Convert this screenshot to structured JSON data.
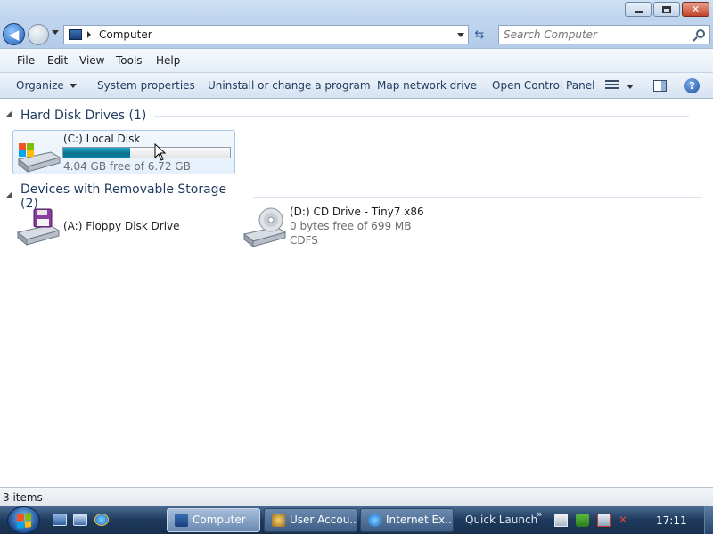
{
  "window": {
    "caption_buttons": {
      "minimize": "minimize",
      "maximize": "maximize",
      "close": "✕"
    }
  },
  "address": {
    "path": "Computer",
    "search_placeholder": "Search Computer"
  },
  "menu": {
    "items": [
      "File",
      "Edit",
      "View",
      "Tools",
      "Help"
    ]
  },
  "commands": {
    "items": [
      "Organize",
      "System properties",
      "Uninstall or change a program",
      "Map network drive",
      "Open Control Panel"
    ]
  },
  "groups": [
    {
      "header": "Hard Disk Drives (1)",
      "tiles": [
        {
          "name": "(C:) Local Disk",
          "detail": "4.04 GB free of 6.72 GB",
          "used_fraction": 0.4
        }
      ]
    },
    {
      "header": "Devices with Removable Storage (2)",
      "tiles": [
        {
          "name": "(A:) Floppy Disk Drive"
        },
        {
          "name": "(D:) CD Drive - Tiny7 x86",
          "detail": "0 bytes free of 699 MB",
          "filesystem": "CDFS"
        }
      ]
    }
  ],
  "status": {
    "text": "3 items"
  },
  "taskbar": {
    "buttons": [
      "Computer",
      "User Accou...",
      "Internet Ex..."
    ],
    "quick_launch_label": "Quick Launch",
    "clock": "17:11"
  },
  "colors": {
    "progress_fill": "#0a86a5",
    "taskbar": "#1f3a5d",
    "accent": "#1e5fb4"
  }
}
